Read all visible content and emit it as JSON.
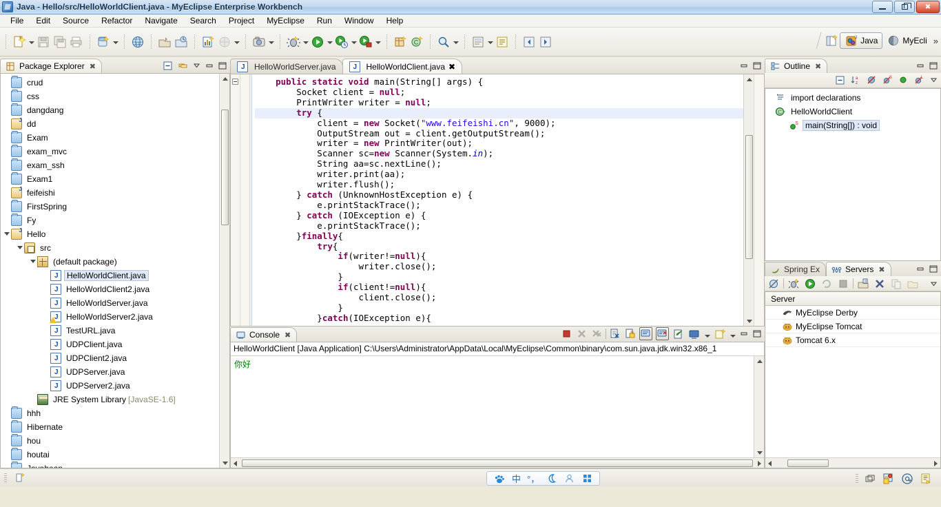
{
  "window": {
    "title": "Java - Hello/src/HelloWorldClient.java - MyEclipse Enterprise Workbench",
    "app_icon": "myeclipse-icon",
    "minimize_label": "Minimize",
    "restore_label": "Restore",
    "close_label": "Close"
  },
  "menubar": {
    "items": [
      {
        "label": "File",
        "mnemonic": "F"
      },
      {
        "label": "Edit",
        "mnemonic": "E"
      },
      {
        "label": "Source",
        "mnemonic": "S"
      },
      {
        "label": "Refactor",
        "mnemonic": "t"
      },
      {
        "label": "Navigate",
        "mnemonic": "N"
      },
      {
        "label": "Search",
        "mnemonic": "r"
      },
      {
        "label": "Project",
        "mnemonic": "P"
      },
      {
        "label": "MyEclipse",
        "mnemonic": ""
      },
      {
        "label": "Run",
        "mnemonic": "R"
      },
      {
        "label": "Window",
        "mnemonic": "W"
      },
      {
        "label": "Help",
        "mnemonic": "H"
      }
    ]
  },
  "toolbar": {
    "groups": [
      {
        "icons": [
          "new-wizard-icon",
          "dropdown-arrow",
          "save-icon",
          "save-all-icon",
          "print-icon"
        ]
      },
      {
        "icons": [
          "undo-icon",
          "dropdown-arrow",
          "redo-icon",
          "dropdown-arrow",
          "back-icon",
          "forward-icon",
          "dropdown-arrow",
          "next-icon",
          "dropdown-arrow"
        ]
      },
      {
        "icons": [
          "myeclipse-db-icon",
          "dropdown-arrow"
        ]
      },
      {
        "icons": [
          "web-browser-icon"
        ]
      },
      {
        "icons": [
          "deploy-icon",
          "refresh-deploy-icon"
        ]
      },
      {
        "icons": [
          "report-icon",
          "globe-disabled-icon",
          "dropdown-arrow"
        ]
      },
      {
        "icons": [
          "snapshot-icon",
          "dropdown-arrow"
        ]
      },
      {
        "icons": [
          "debug-icon",
          "dropdown-arrow",
          "run-icon",
          "dropdown-arrow",
          "run-history-icon",
          "dropdown-arrow",
          "run-external-icon",
          "dropdown-arrow"
        ]
      },
      {
        "icons": [
          "new-java-package-icon",
          "new-class-icon"
        ]
      },
      {
        "icons": [
          "search-icon",
          "dropdown-arrow"
        ]
      },
      {
        "icons": [
          "open-type-icon",
          "dropdown-arrow"
        ]
      },
      {
        "icons": [
          "pin-editor-icon",
          "dropdown-arrow",
          "annotation-icon"
        ]
      },
      {
        "icons": [
          "prev-edit-icon",
          "next-edit-icon"
        ]
      }
    ],
    "perspective": {
      "open_perspective_icon": "open-perspective-icon",
      "items": [
        {
          "label": "Java",
          "icon": "java-perspective-icon",
          "active": true
        },
        {
          "label": "MyEcli",
          "icon": "myeclipse-perspective-icon",
          "active": false
        }
      ],
      "overflow": "»"
    }
  },
  "package_explorer": {
    "tab_label": "Package Explorer",
    "tab_icon": "package-explorer-icon",
    "close_glyph": "✖",
    "toolbar_icons": [
      "collapse-all-icon",
      "link-with-editor-icon",
      "view-menu-icon",
      "minimize-icon",
      "maximize-icon"
    ],
    "tree": [
      {
        "label": "crud",
        "indent": 1,
        "icon": "folder-icon"
      },
      {
        "label": "css",
        "indent": 1,
        "icon": "folder-icon"
      },
      {
        "label": "dangdang",
        "indent": 1,
        "icon": "folder-icon"
      },
      {
        "label": "dd",
        "indent": 1,
        "icon": "java-project-icon"
      },
      {
        "label": "Exam",
        "indent": 1,
        "icon": "folder-icon"
      },
      {
        "label": "exam_mvc",
        "indent": 1,
        "icon": "folder-icon"
      },
      {
        "label": "exam_ssh",
        "indent": 1,
        "icon": "folder-icon"
      },
      {
        "label": "Exam1",
        "indent": 1,
        "icon": "folder-icon"
      },
      {
        "label": "feifeishi",
        "indent": 1,
        "icon": "java-project-icon"
      },
      {
        "label": "FirstSpring",
        "indent": 1,
        "icon": "folder-icon"
      },
      {
        "label": "Fy",
        "indent": 1,
        "icon": "folder-icon"
      },
      {
        "label": "Hello",
        "indent": 1,
        "icon": "java-project-icon",
        "expanded": true
      },
      {
        "label": "src",
        "indent": 2,
        "icon": "source-folder-icon",
        "expanded": true
      },
      {
        "label": "(default package)",
        "indent": 3,
        "icon": "package-icon",
        "expanded": true
      },
      {
        "label": "HelloWorldClient.java",
        "indent": 4,
        "icon": "java-file-icon",
        "selected": true
      },
      {
        "label": "HelloWorldClient2.java",
        "indent": 4,
        "icon": "java-file-icon"
      },
      {
        "label": "HelloWorldServer.java",
        "indent": 4,
        "icon": "java-file-icon"
      },
      {
        "label": "HelloWorldServer2.java",
        "indent": 4,
        "icon": "java-file-warning-icon"
      },
      {
        "label": "TestURL.java",
        "indent": 4,
        "icon": "java-file-icon"
      },
      {
        "label": "UDPClient.java",
        "indent": 4,
        "icon": "java-file-icon"
      },
      {
        "label": "UDPClient2.java",
        "indent": 4,
        "icon": "java-file-icon"
      },
      {
        "label": "UDPServer.java",
        "indent": 4,
        "icon": "java-file-icon"
      },
      {
        "label": "UDPServer2.java",
        "indent": 4,
        "icon": "java-file-icon"
      },
      {
        "label": "JRE System Library",
        "indent": 3,
        "icon": "jre-library-icon",
        "suffix": "[JavaSE-1.6]"
      },
      {
        "label": "hhh",
        "indent": 1,
        "icon": "folder-icon"
      },
      {
        "label": "Hibernate",
        "indent": 1,
        "icon": "folder-icon"
      },
      {
        "label": "hou",
        "indent": 1,
        "icon": "folder-icon"
      },
      {
        "label": "houtai",
        "indent": 1,
        "icon": "folder-icon"
      },
      {
        "label": "Javabean",
        "indent": 1,
        "icon": "folder-icon"
      }
    ]
  },
  "editor": {
    "tabs": [
      {
        "label": "HelloWorldServer.java",
        "icon": "java-file-icon",
        "active": false
      },
      {
        "label": "HelloWorldClient.java",
        "icon": "java-file-icon",
        "active": true,
        "close_glyph": "✖"
      }
    ],
    "minimize_icon": "minimize-icon",
    "maximize_icon": "maximize-icon",
    "highlighted_line": 4,
    "lines": [
      [
        {
          "t": "    ",
          "c": ""
        },
        {
          "t": "public static void ",
          "c": "kw"
        },
        {
          "t": "main(String[] args) {",
          "c": ""
        }
      ],
      [
        {
          "t": "        Socket client = ",
          "c": ""
        },
        {
          "t": "null",
          "c": "kw"
        },
        {
          "t": ";",
          "c": ""
        }
      ],
      [
        {
          "t": "        PrintWriter writer = ",
          "c": ""
        },
        {
          "t": "null",
          "c": "kw"
        },
        {
          "t": ";",
          "c": ""
        }
      ],
      [
        {
          "t": "        ",
          "c": ""
        },
        {
          "t": "try",
          "c": "kw"
        },
        {
          "t": " {",
          "c": ""
        }
      ],
      [
        {
          "t": "            client = ",
          "c": ""
        },
        {
          "t": "new",
          "c": "kw"
        },
        {
          "t": " Socket(",
          "c": ""
        },
        {
          "t": "\"www.feifeishi.cn\"",
          "c": "str"
        },
        {
          "t": ", 9000);",
          "c": ""
        }
      ],
      [
        {
          "t": "            OutputStream out = client.getOutputStream();",
          "c": ""
        }
      ],
      [
        {
          "t": "            writer = ",
          "c": ""
        },
        {
          "t": "new",
          "c": "kw"
        },
        {
          "t": " PrintWriter(out);",
          "c": ""
        }
      ],
      [
        {
          "t": "            Scanner sc=",
          "c": ""
        },
        {
          "t": "new",
          "c": "kw"
        },
        {
          "t": " Scanner(System.",
          "c": ""
        },
        {
          "t": "in",
          "c": "fld"
        },
        {
          "t": ");",
          "c": ""
        }
      ],
      [
        {
          "t": "            String aa=sc.nextLine();",
          "c": ""
        }
      ],
      [
        {
          "t": "            writer.print(aa);",
          "c": ""
        }
      ],
      [
        {
          "t": "            writer.flush();",
          "c": ""
        }
      ],
      [
        {
          "t": "        } ",
          "c": ""
        },
        {
          "t": "catch",
          "c": "kw"
        },
        {
          "t": " (UnknownHostException e) {",
          "c": ""
        }
      ],
      [
        {
          "t": "            e.printStackTrace();",
          "c": ""
        }
      ],
      [
        {
          "t": "        } ",
          "c": ""
        },
        {
          "t": "catch",
          "c": "kw"
        },
        {
          "t": " (IOException e) {",
          "c": ""
        }
      ],
      [
        {
          "t": "            e.printStackTrace();",
          "c": ""
        }
      ],
      [
        {
          "t": "        }",
          "c": ""
        },
        {
          "t": "finally",
          "c": "kw"
        },
        {
          "t": "{",
          "c": ""
        }
      ],
      [
        {
          "t": "            ",
          "c": ""
        },
        {
          "t": "try",
          "c": "kw"
        },
        {
          "t": "{",
          "c": ""
        }
      ],
      [
        {
          "t": "                ",
          "c": ""
        },
        {
          "t": "if",
          "c": "kw"
        },
        {
          "t": "(writer!=",
          "c": ""
        },
        {
          "t": "null",
          "c": "kw"
        },
        {
          "t": "){",
          "c": ""
        }
      ],
      [
        {
          "t": "                    writer.close();",
          "c": ""
        }
      ],
      [
        {
          "t": "                }",
          "c": ""
        }
      ],
      [
        {
          "t": "                ",
          "c": ""
        },
        {
          "t": "if",
          "c": "kw"
        },
        {
          "t": "(client!=",
          "c": ""
        },
        {
          "t": "null",
          "c": "kw"
        },
        {
          "t": "){",
          "c": ""
        }
      ],
      [
        {
          "t": "                    client.close();",
          "c": ""
        }
      ],
      [
        {
          "t": "                }",
          "c": ""
        }
      ],
      [
        {
          "t": "            }",
          "c": ""
        },
        {
          "t": "catch",
          "c": "kw"
        },
        {
          "t": "(IOException e){",
          "c": ""
        }
      ]
    ]
  },
  "console": {
    "tab_label": "Console",
    "tab_icon": "console-icon",
    "close_glyph": "✖",
    "toolbar_icons": [
      "terminate-icon",
      "remove-launch-icon",
      "remove-all-launches-icon",
      "clear-console-icon",
      "lock-scroll-icon",
      "show-console-on-output-icon",
      "show-console-on-error-icon",
      "open-console-icon",
      "display-selected-console-icon",
      "dropdown-arrow",
      "new-console-view-icon",
      "dropdown-arrow",
      "minimize-icon",
      "maximize-icon"
    ],
    "launch_line": "HelloWorldClient [Java Application] C:\\Users\\Administrator\\AppData\\Local\\MyEclipse\\Common\\binary\\com.sun.java.jdk.win32.x86_1",
    "output": "你好"
  },
  "outline": {
    "tab_label": "Outline",
    "tab_icon": "outline-icon",
    "close_glyph": "✖",
    "toolbar_icons": [
      "collapse-all-icon",
      "sort-icon",
      "hide-fields-icon",
      "hide-static-icon",
      "hide-non-public-icon",
      "hide-local-types-icon",
      "view-menu-icon"
    ],
    "minimize_icon": "minimize-icon",
    "maximize_icon": "maximize-icon",
    "items": [
      {
        "label": "import declarations",
        "icon": "import-declarations-icon",
        "indent": 1
      },
      {
        "label": "HelloWorldClient",
        "icon": "class-icon",
        "indent": 1
      },
      {
        "label": "main(String[]) : void",
        "icon": "method-public-static-icon",
        "indent": 2,
        "selected": true
      }
    ]
  },
  "servers": {
    "tabs": [
      {
        "label": "Spring Ex",
        "icon": "spring-explorer-icon",
        "active": false
      },
      {
        "label": "Servers",
        "icon": "servers-icon",
        "active": true,
        "close_glyph": "✖"
      }
    ],
    "minimize_icon": "minimize-icon",
    "maximize_icon": "maximize-icon",
    "toolbar_icons": [
      "debug-server-icon",
      "start-debug-icon",
      "start-server-icon",
      "restart-icon",
      "stop-server-icon",
      "add-deployment-icon",
      "remove-icon",
      "copy-icon",
      "open-icon",
      "view-menu-icon"
    ],
    "column_header": "Server",
    "rows": [
      {
        "label": "MyEclipse Derby",
        "icon": "derby-icon"
      },
      {
        "label": "MyEclipse Tomcat",
        "icon": "tomcat-icon"
      },
      {
        "label": "Tomcat  6.x",
        "icon": "tomcat-icon"
      }
    ]
  },
  "statusbar": {
    "left_icon": "writable-indicator-icon",
    "ime": {
      "logo": "sogou-paw-icon",
      "mode": "中",
      "punctuation": "°，",
      "moon": "moon-icon",
      "user": "user-icon",
      "grid": "grid-icon"
    },
    "tray_icons": [
      "restore-windows-icon",
      "security-alert-icon",
      "email-icon",
      "notes-icon"
    ]
  },
  "colors": {
    "accent": "#2a6fc0",
    "keyword": "#7f0055",
    "string": "#2a00ff",
    "field": "#0000c0",
    "console_output": "#008000",
    "selection": "#dfe8f6",
    "highlight_line": "#e8eefb"
  }
}
